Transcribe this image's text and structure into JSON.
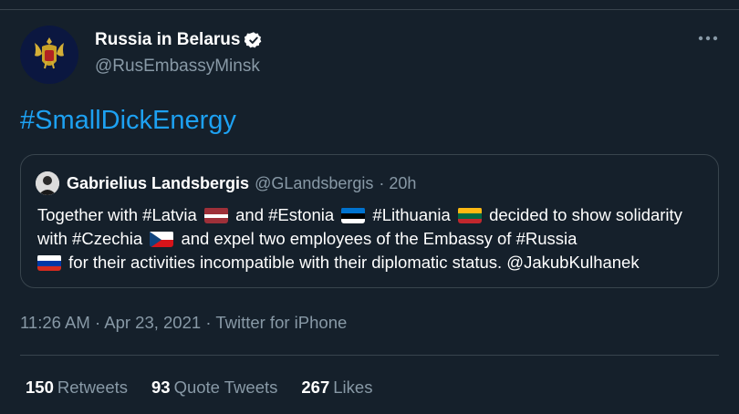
{
  "author": {
    "display_name": "Russia in Belarus",
    "handle": "@RusEmbassyMinsk",
    "avatar_icon": "double-headed-eagle-emblem-icon",
    "verified": true
  },
  "tweet": {
    "text": "#SmallDickEnergy"
  },
  "quoted_tweet": {
    "display_name": "Gabrielius Landsbergis",
    "handle": "@GLandsbergis",
    "time": "· 20h",
    "segments": {
      "s1": "Together with #Latvia",
      "s2": "and #Estonia",
      "s3": "#Lithuania",
      "s4": "decided to show solidarity with #Czechia",
      "s5": "and expel two employees of the Embassy of #Russia",
      "s6": "for their activities incompatible with their diplomatic status. @JakubKulhanek"
    }
  },
  "meta": {
    "time": "11:26 AM",
    "sep1": "·",
    "date": "Apr 23, 2021",
    "sep2": "·",
    "source": "Twitter for iPhone"
  },
  "stats": {
    "retweets_count": "150",
    "retweets_label": "Retweets",
    "quotes_count": "93",
    "quotes_label": "Quote Tweets",
    "likes_count": "267",
    "likes_label": "Likes"
  },
  "colors": {
    "background": "#15202b",
    "accent": "#1da1f2",
    "secondary_text": "#8899a6",
    "border": "#38444d"
  }
}
